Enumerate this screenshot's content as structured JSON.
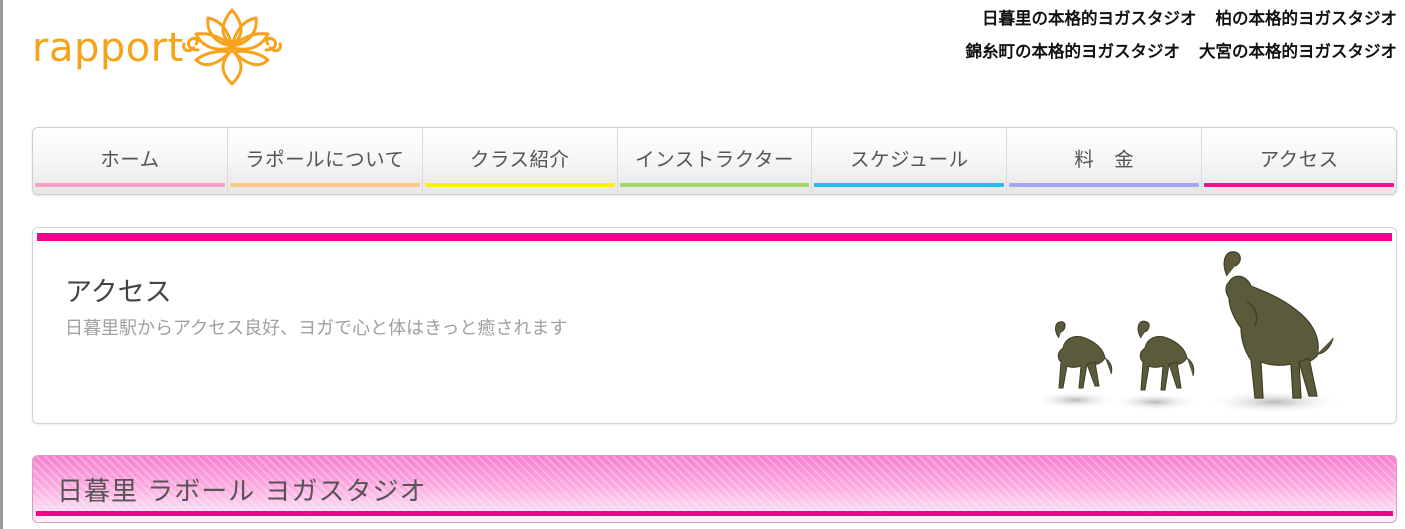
{
  "logo": {
    "text": "rapport",
    "color": "#f7a21b"
  },
  "header_links": [
    [
      "日暮里の本格的ヨガスタジオ",
      "柏の本格的ヨガスタジオ"
    ],
    [
      "錦糸町の本格的ヨガスタジオ",
      "大宮の本格的ヨガスタジオ"
    ]
  ],
  "nav": [
    {
      "label": "ホーム",
      "color": "#f59fc4"
    },
    {
      "label": "ラポールについて",
      "color": "#fbc98b"
    },
    {
      "label": "クラス紹介",
      "color": "#f8ee1c"
    },
    {
      "label": "インストラクター",
      "color": "#9ed96b"
    },
    {
      "label": "スケジュール",
      "color": "#1ebcf0"
    },
    {
      "label": "料　金",
      "color": "#a7a5f3"
    },
    {
      "label": "アクセス",
      "color": "#f0118a"
    }
  ],
  "hero": {
    "title": "アクセス",
    "subtitle": "日暮里駅からアクセス良好、ヨガで心と体はきっと癒されます",
    "accent": "#f0058c"
  },
  "section": {
    "title": "日暮里 ラボール ヨガスタジオ",
    "accent": "#f0058c"
  }
}
